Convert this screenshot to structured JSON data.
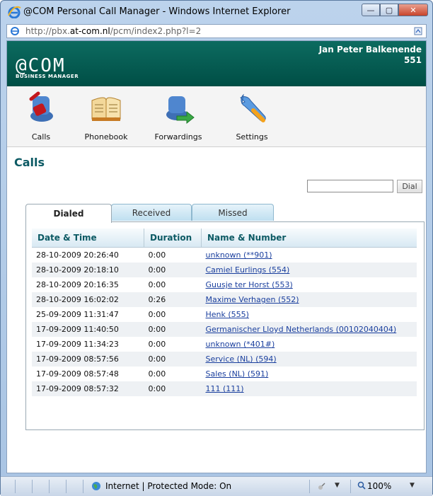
{
  "window": {
    "title": "@COM Personal Call Manager - Windows Internet Explorer",
    "controls": {
      "minimize": "—",
      "maximize": "▢",
      "close": "✕"
    }
  },
  "address_bar": {
    "url_prefix": "http://pbx.",
    "url_domain": "at-com.nl",
    "url_path": "/pcm/index2.php?l=2"
  },
  "header": {
    "logo_main": "@COM",
    "logo_sub": "BUSINESS MANAGER",
    "user_name": "Jan Peter Balkenende",
    "user_ext": "551",
    "bg_color": "#005a50"
  },
  "toolbar": {
    "items": [
      {
        "label": "Calls",
        "icon": "calls-icon"
      },
      {
        "label": "Phonebook",
        "icon": "phonebook-icon"
      },
      {
        "label": "Forwardings",
        "icon": "forwardings-icon"
      },
      {
        "label": "Settings",
        "icon": "settings-icon"
      }
    ]
  },
  "main": {
    "page_title": "Calls",
    "dial_input_value": "",
    "dial_button": "Dial",
    "tabs": [
      {
        "label": "Dialed",
        "active": true
      },
      {
        "label": "Received",
        "active": false
      },
      {
        "label": "Missed",
        "active": false
      }
    ],
    "columns": [
      "Date & Time",
      "Duration",
      "Name & Number"
    ],
    "rows": [
      {
        "datetime": "28-10-2009 20:26:40",
        "duration": "0:00",
        "name": "unknown (**901)"
      },
      {
        "datetime": "28-10-2009 20:18:10",
        "duration": "0:00",
        "name": "Camiel Eurlings (554)"
      },
      {
        "datetime": "28-10-2009 20:16:35",
        "duration": "0:00",
        "name": "Guusje ter Horst (553)"
      },
      {
        "datetime": "28-10-2009 16:02:02",
        "duration": "0:26",
        "name": "Maxime Verhagen (552)"
      },
      {
        "datetime": "25-09-2009 11:31:47",
        "duration": "0:00",
        "name": "Henk (555)"
      },
      {
        "datetime": "17-09-2009 11:40:50",
        "duration": "0:00",
        "name": "Germanischer Lloyd Netherlands (00102040404)"
      },
      {
        "datetime": "17-09-2009 11:34:23",
        "duration": "0:00",
        "name": "unknown (*401#)"
      },
      {
        "datetime": "17-09-2009 08:57:56",
        "duration": "0:00",
        "name": "Service (NL) (594)"
      },
      {
        "datetime": "17-09-2009 08:57:48",
        "duration": "0:00",
        "name": "Sales (NL) (591)"
      },
      {
        "datetime": "17-09-2009 08:57:32",
        "duration": "0:00",
        "name": "111 (111)"
      }
    ]
  },
  "status_bar": {
    "zone_text": "Internet | Protected Mode: On",
    "zoom": "100%"
  }
}
